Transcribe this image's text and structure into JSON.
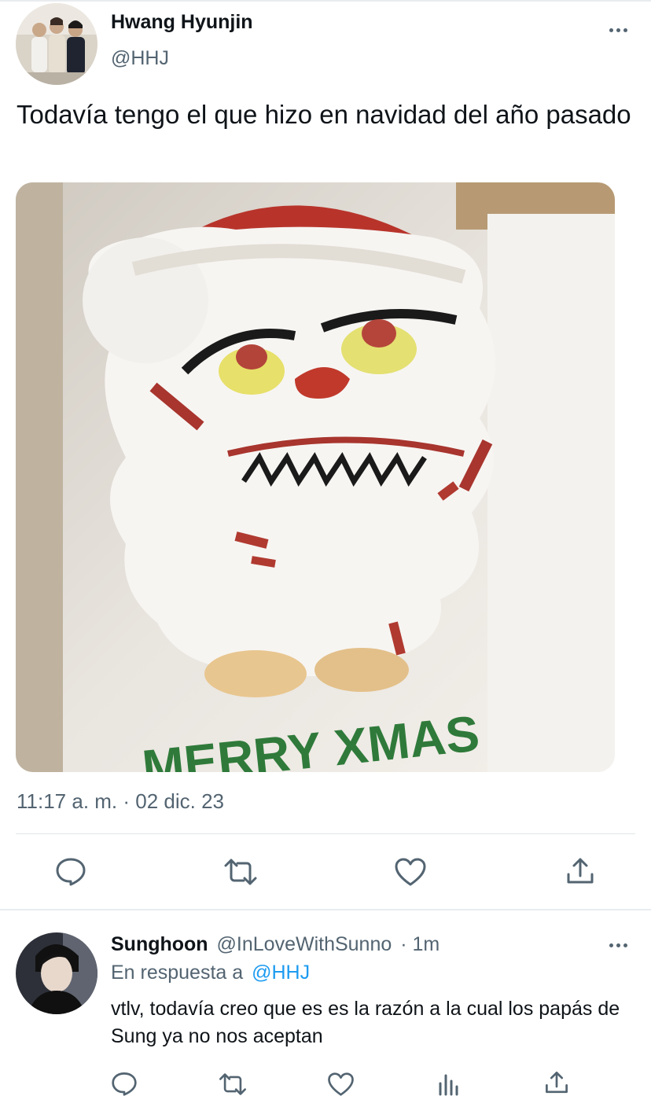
{
  "tweet": {
    "author_name": "Hwang Hyunjin",
    "author_handle": "@HHJ",
    "text": "Todavía tengo el que hizo en navidad del año pasado",
    "image_text": "MERRY XMAS",
    "timestamp": "11:17 a. m. · 02 dic. 23",
    "actions": [
      "reply-icon",
      "retweet-icon",
      "like-icon",
      "share-icon"
    ]
  },
  "reply": {
    "author_name": "Sunghoon",
    "author_handle": "@InLoveWithSunno",
    "time": "· 1m",
    "replying_prefix": "En respuesta a",
    "replying_to": "@HHJ",
    "text": "vtlv, todavía creo que es es la razón a la cual los papás de Sung ya no nos aceptan",
    "actions": [
      "reply-icon",
      "retweet-icon",
      "like-icon",
      "views-icon",
      "share-icon"
    ]
  },
  "colors": {
    "text_primary": "#0f1419",
    "text_secondary": "#536471",
    "link": "#1d9bf0",
    "divider": "#e1e6ea"
  }
}
